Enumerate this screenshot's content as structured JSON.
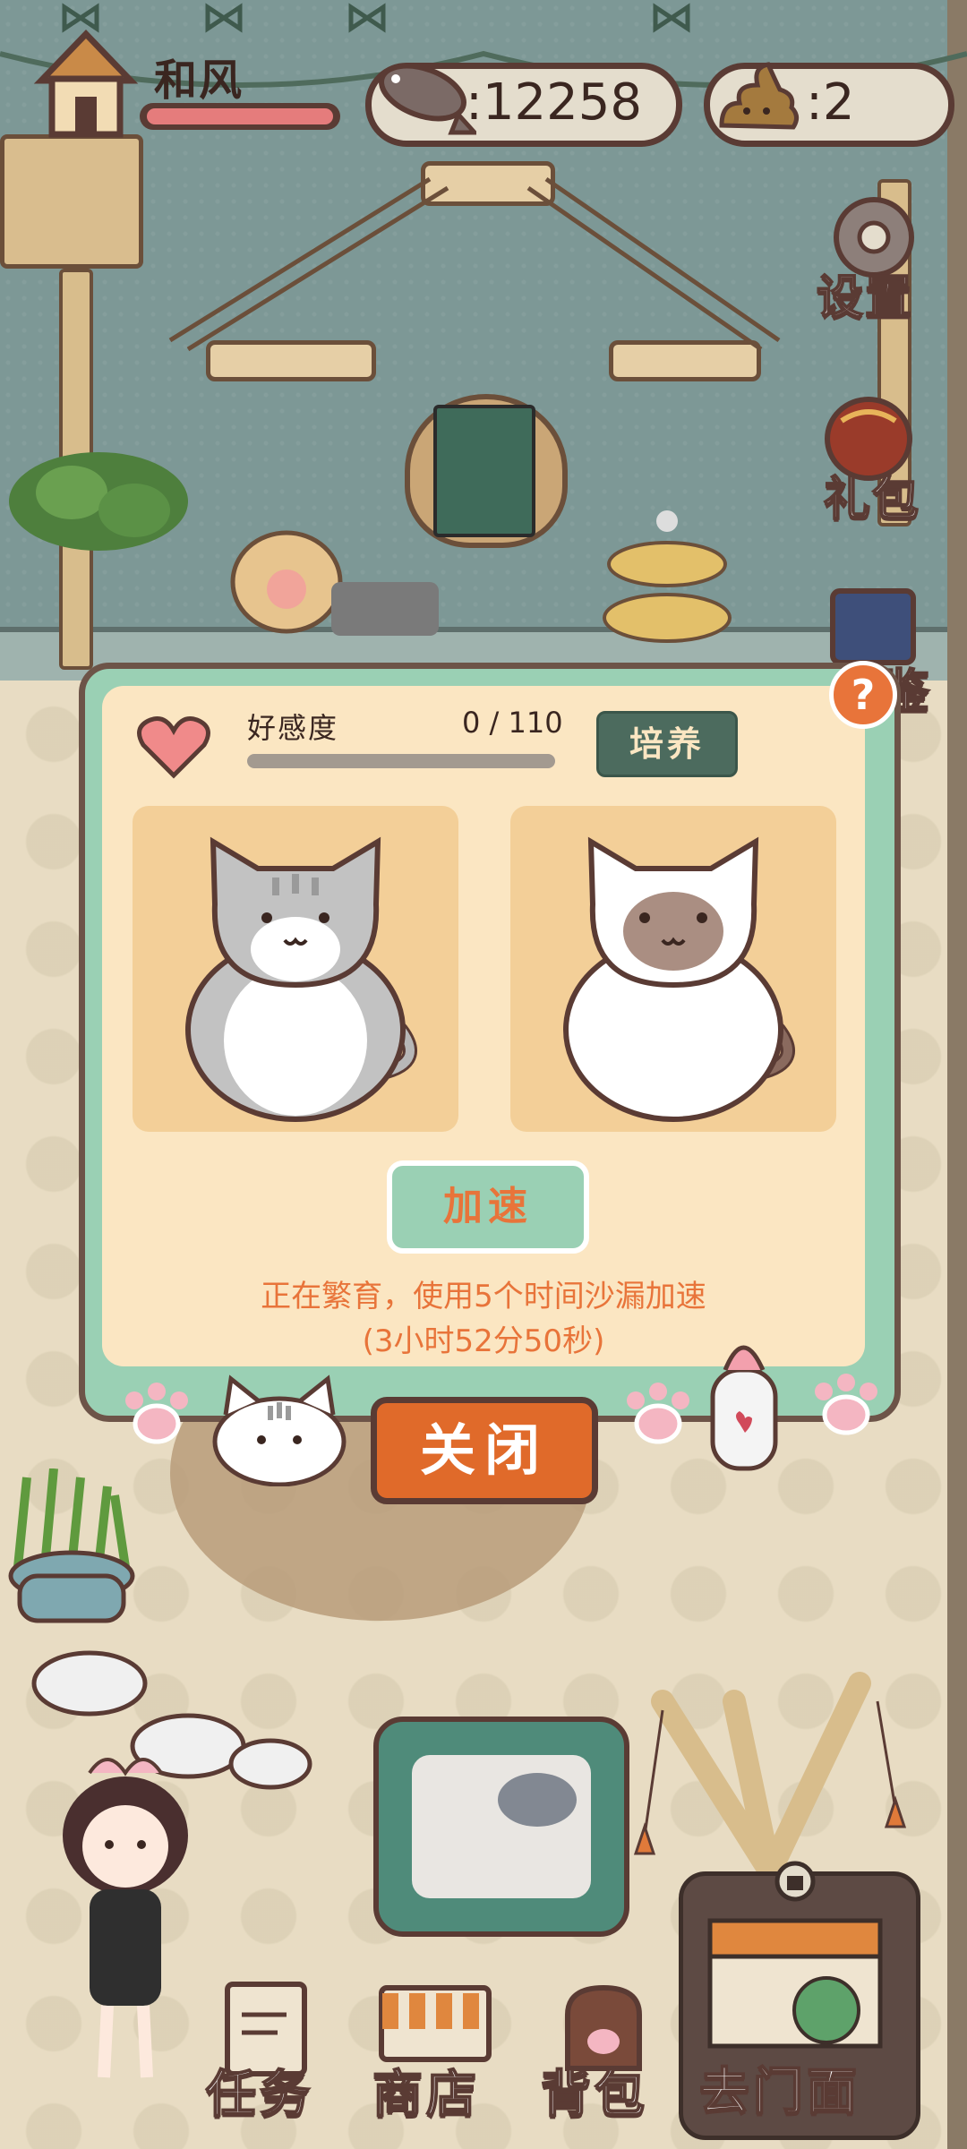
{
  "player": {
    "name": "和风",
    "name_bar_percent": 100
  },
  "currency": {
    "fish": "12258",
    "poop": "2"
  },
  "side_buttons": {
    "settings": "设置",
    "gift": "礼包",
    "handbook": "鉴"
  },
  "popup": {
    "help": "?",
    "affection_label": "好感度",
    "affection_value": "0 / 110",
    "affection_percent": 0,
    "cultivate_button": "培养",
    "speed_button": "加速",
    "status_line1": "正在繁育，使用5个时间沙漏加速",
    "status_line2": "(3小时52分50秒)",
    "close_button": "关闭"
  },
  "bottom_nav": {
    "tasks": "任务",
    "shop": "商店",
    "backpack": "背包",
    "go_store": "去门面"
  },
  "colors": {
    "wall": "#7d9896",
    "popup_frame": "#9ad0b4",
    "popup_panel": "#fbe6c2",
    "accent_orange": "#e8743a",
    "heart": "#f08a8a"
  }
}
